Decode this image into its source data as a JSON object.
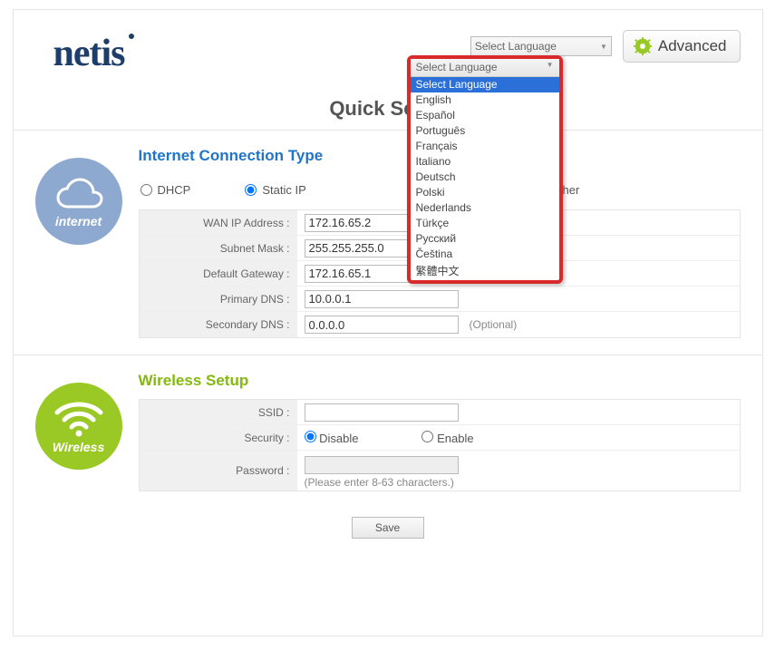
{
  "header": {
    "logo_text": "netis",
    "language_selected": "Select Language",
    "advanced_label": "Advanced"
  },
  "title": "Quick Setup",
  "language_options": [
    "Select Language",
    "English",
    "Español",
    "Português",
    "Français",
    "Italiano",
    "Deutsch",
    "Polski",
    "Nederlands",
    "Türkçe",
    "Русский",
    "Čeština",
    "繁體中文"
  ],
  "language_selected_index": 0,
  "internet": {
    "section_title": "Internet Connection Type",
    "badge_label": "internet",
    "types": {
      "dhcp": "DHCP",
      "static": "Static IP",
      "other": "Other"
    },
    "selected_type": "static",
    "fields": {
      "wan_ip_label": "WAN IP Address :",
      "wan_ip_value": "172.16.65.2",
      "subnet_label": "Subnet Mask :",
      "subnet_value": "255.255.255.0",
      "gateway_label": "Default Gateway :",
      "gateway_value": "172.16.65.1",
      "pdns_label": "Primary DNS :",
      "pdns_value": "10.0.0.1",
      "sdns_label": "Secondary DNS :",
      "sdns_value": "0.0.0.0",
      "optional_hint": "(Optional)"
    }
  },
  "wireless": {
    "section_title": "Wireless Setup",
    "badge_label": "Wireless",
    "ssid_label": "SSID :",
    "ssid_value": "",
    "security_label": "Security :",
    "security_disable": "Disable",
    "security_enable": "Enable",
    "security_selected": "disable",
    "password_label": "Password :",
    "password_value": "",
    "password_hint": "(Please enter 8-63 characters.)"
  },
  "save_label": "Save"
}
